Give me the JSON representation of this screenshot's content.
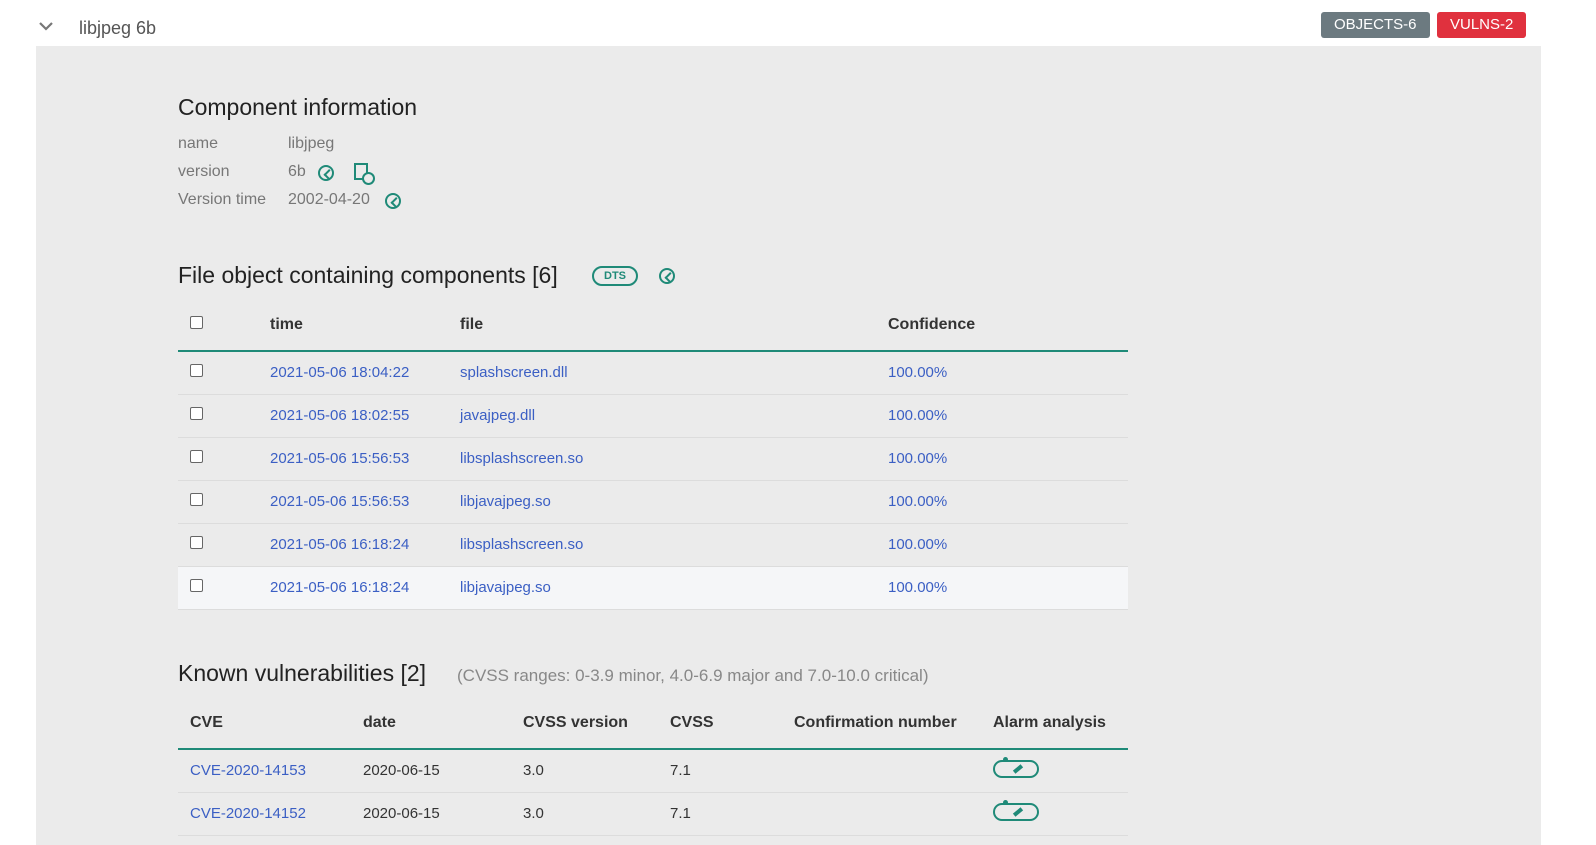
{
  "header": {
    "component_title": "libjpeg 6b",
    "badges": {
      "objects": "OBJECTS-6",
      "vulns": "VULNS-2"
    }
  },
  "component_info": {
    "title": "Component information",
    "rows": [
      {
        "label": "name",
        "value": "libjpeg"
      },
      {
        "label": "version",
        "value": "6b"
      },
      {
        "label": "Version time",
        "value": "2002-04-20"
      }
    ]
  },
  "file_objects": {
    "title": "File object containing components [6]",
    "dts_label": "DTS",
    "columns": [
      "time",
      "file",
      "Confidence"
    ],
    "rows": [
      {
        "time": "2021-05-06 18:04:22",
        "file": "splashscreen.dll",
        "confidence": "100.00%"
      },
      {
        "time": "2021-05-06 18:02:55",
        "file": "javajpeg.dll",
        "confidence": "100.00%"
      },
      {
        "time": "2021-05-06 15:56:53",
        "file": "libsplashscreen.so",
        "confidence": "100.00%"
      },
      {
        "time": "2021-05-06 15:56:53",
        "file": "libjavajpeg.so",
        "confidence": "100.00%"
      },
      {
        "time": "2021-05-06 16:18:24",
        "file": "libsplashscreen.so",
        "confidence": "100.00%"
      },
      {
        "time": "2021-05-06 16:18:24",
        "file": "libjavajpeg.so",
        "confidence": "100.00%"
      }
    ]
  },
  "vulnerabilities": {
    "title": "Known vulnerabilities [2]",
    "note": "(CVSS ranges: 0-3.9 minor, 4.0-6.9 major and 7.0-10.0 critical)",
    "columns": [
      "CVE",
      "date",
      "CVSS version",
      "CVSS",
      "Confirmation number",
      "Alarm analysis"
    ],
    "rows": [
      {
        "cve": "CVE-2020-14153",
        "date": "2020-06-15",
        "cvss_version": "3.0",
        "cvss": "7.1",
        "confirmation": ""
      },
      {
        "cve": "CVE-2020-14152",
        "date": "2020-06-15",
        "cvss_version": "3.0",
        "cvss": "7.1",
        "confirmation": ""
      }
    ]
  },
  "colors": {
    "accent": "#1f8a78",
    "link": "#3b5fc4",
    "vulns_badge": "#e0313e",
    "objects_badge": "#6c7a80",
    "panel_bg": "#ebebeb"
  }
}
